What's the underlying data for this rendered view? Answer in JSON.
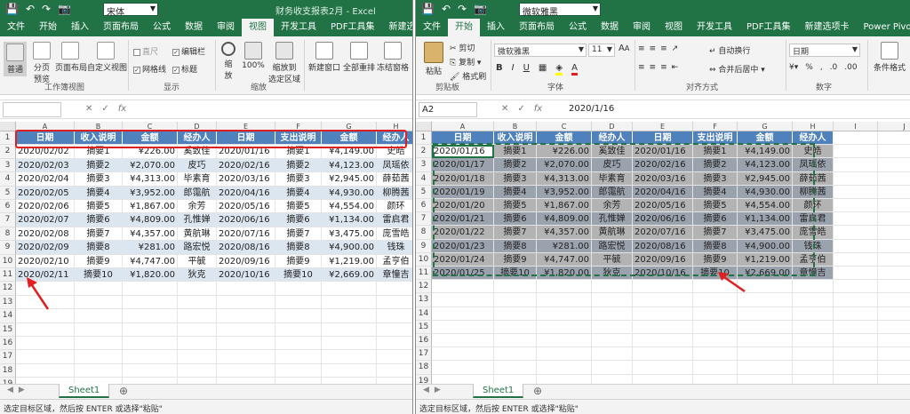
{
  "left": {
    "qat": [
      "💾",
      "↶",
      "↷",
      "📷"
    ],
    "font_name": "宋体",
    "title": "财务收支报表2月 - Excel",
    "tabs": [
      "文件",
      "开始",
      "插入",
      "页面布局",
      "公式",
      "数据",
      "审阅",
      "视图",
      "开发工具",
      "PDF工具集",
      "新建选项卡"
    ],
    "active_tab": "视图",
    "ribbon": {
      "normal": "普通",
      "pagebreak": "分页\n预览",
      "pagelayout": "页面布局",
      "custom": "自定义视图",
      "group_views": "工作簿视图",
      "ruler": "直尺",
      "gridlines": "网格线",
      "formulabar": "编辑栏",
      "headings": "标题",
      "group_show": "显示",
      "zoom": "缩\n放",
      "zoom100": "100%",
      "zoomsel": "缩放到\n选定区域",
      "group_zoom": "缩放",
      "newwin": "新建窗口",
      "arrange": "全部重排",
      "freeze": "冻结窗格"
    },
    "name_box": "",
    "fx": "fx",
    "formula": "",
    "columns": [
      "A",
      "B",
      "C",
      "D",
      "E",
      "F",
      "G",
      "H"
    ],
    "header": [
      "日期",
      "收入说明",
      "金额",
      "经办人",
      "日期",
      "支出说明",
      "金额",
      "经办人"
    ],
    "rows": [
      [
        "2020/02/02",
        "摘要1",
        "¥226.00",
        "奚致佳",
        "2020/01/16",
        "摘要1",
        "¥4,149.00",
        "史皓"
      ],
      [
        "2020/02/03",
        "摘要2",
        "¥2,070.00",
        "皮巧",
        "2020/02/16",
        "摘要2",
        "¥4,123.00",
        "凤瑶依"
      ],
      [
        "2020/02/04",
        "摘要3",
        "¥4,313.00",
        "毕素育",
        "2020/03/16",
        "摘要3",
        "¥2,945.00",
        "薛茹茜"
      ],
      [
        "2020/02/05",
        "摘要4",
        "¥3,952.00",
        "郎霭航",
        "2020/04/16",
        "摘要4",
        "¥4,930.00",
        "柳腾茜"
      ],
      [
        "2020/02/06",
        "摘要5",
        "¥1,867.00",
        "余芳",
        "2020/05/16",
        "摘要5",
        "¥4,554.00",
        "颜环"
      ],
      [
        "2020/02/07",
        "摘要6",
        "¥4,809.00",
        "孔惟婵",
        "2020/06/16",
        "摘要6",
        "¥1,134.00",
        "雷启君"
      ],
      [
        "2020/02/08",
        "摘要7",
        "¥4,357.00",
        "黄航琳",
        "2020/07/16",
        "摘要7",
        "¥3,475.00",
        "庞雪皓"
      ],
      [
        "2020/02/09",
        "摘要8",
        "¥281.00",
        "路宏悦",
        "2020/08/16",
        "摘要8",
        "¥4,900.00",
        "钱珠"
      ],
      [
        "2020/02/10",
        "摘要9",
        "¥4,747.00",
        "平毓",
        "2020/09/16",
        "摘要9",
        "¥1,219.00",
        "孟亨伯"
      ],
      [
        "2020/02/11",
        "摘要10",
        "¥1,820.00",
        "狄克",
        "2020/10/16",
        "摘要10",
        "¥2,669.00",
        "章憧吉"
      ]
    ],
    "sheet": "Sheet1",
    "status": "选定目标区域，然后按 ENTER 或选择\"粘贴\""
  },
  "right": {
    "qat": [
      "💾",
      "↶",
      "↷",
      "📷"
    ],
    "font_name": "微软雅黑",
    "tabs": [
      "文件",
      "开始",
      "插入",
      "页面布局",
      "公式",
      "数据",
      "审阅",
      "视图",
      "开发工具",
      "PDF工具集",
      "新建选项卡",
      "Power Pivot"
    ],
    "active_tab": "开始",
    "ribbon": {
      "paste": "粘贴",
      "cut": "剪切",
      "copy": "复制 ▾",
      "formatpainter": "格式刷",
      "group_clip": "剪贴板",
      "font": "微软雅黑",
      "size": "11",
      "group_font": "字体",
      "wrap": "自动换行",
      "merge": "合并后居中 ▾",
      "group_align": "对齐方式",
      "numfmt": "日期",
      "group_num": "数字",
      "cond": "条件格式"
    },
    "name_box": "A2",
    "fx": "fx",
    "formula": "2020/1/16",
    "columns": [
      "A",
      "B",
      "C",
      "D",
      "E",
      "F",
      "G",
      "H",
      "I",
      "J"
    ],
    "header": [
      "日期",
      "收入说明",
      "金额",
      "经办人",
      "日期",
      "支出说明",
      "金额",
      "经办人"
    ],
    "rows": [
      [
        "2020/01/16",
        "摘要1",
        "¥226.00",
        "奚致佳",
        "2020/01/16",
        "摘要1",
        "¥4,149.00",
        "史皓"
      ],
      [
        "2020/01/17",
        "摘要2",
        "¥2,070.00",
        "皮巧",
        "2020/02/16",
        "摘要2",
        "¥4,123.00",
        "凤瑶依"
      ],
      [
        "2020/01/18",
        "摘要3",
        "¥4,313.00",
        "毕素育",
        "2020/03/16",
        "摘要3",
        "¥2,945.00",
        "薛茹茜"
      ],
      [
        "2020/01/19",
        "摘要4",
        "¥3,952.00",
        "郎霭航",
        "2020/04/16",
        "摘要4",
        "¥4,930.00",
        "柳腾茜"
      ],
      [
        "2020/01/20",
        "摘要5",
        "¥1,867.00",
        "余芳",
        "2020/05/16",
        "摘要5",
        "¥4,554.00",
        "颜环"
      ],
      [
        "2020/01/21",
        "摘要6",
        "¥4,809.00",
        "孔惟婵",
        "2020/06/16",
        "摘要6",
        "¥1,134.00",
        "雷启君"
      ],
      [
        "2020/01/22",
        "摘要7",
        "¥4,357.00",
        "黄航琳",
        "2020/07/16",
        "摘要7",
        "¥3,475.00",
        "庞雪皓"
      ],
      [
        "2020/01/23",
        "摘要8",
        "¥281.00",
        "路宏悦",
        "2020/08/16",
        "摘要8",
        "¥4,900.00",
        "钱珠"
      ],
      [
        "2020/01/24",
        "摘要9",
        "¥4,747.00",
        "平毓",
        "2020/09/16",
        "摘要9",
        "¥1,219.00",
        "孟亨伯"
      ],
      [
        "2020/01/25",
        "摘要10",
        "¥1,820.00",
        "狄克",
        "2020/10/16",
        "摘要10",
        "¥2,669.00",
        "章憧吉"
      ]
    ],
    "sheet": "Sheet1",
    "status": "选定目标区域，然后按 ENTER 或选择\"粘贴\""
  },
  "colors": {
    "excel_green": "#217346",
    "header_blue": "#4f81bd",
    "band_light": "#dce6f1",
    "annot_red": "#e02020",
    "selected_gray": "#a6a6a6"
  }
}
